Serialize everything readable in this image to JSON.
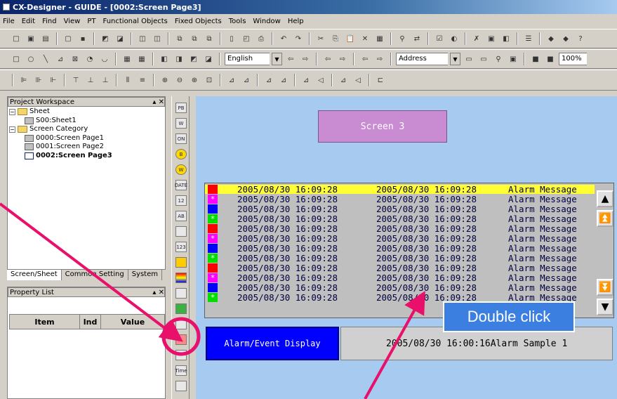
{
  "window": {
    "title": "CX-Designer - GUIDE - [0002:Screen Page3]"
  },
  "menu": [
    "File",
    "Edit",
    "Find",
    "View",
    "PT",
    "Functional Objects",
    "Fixed Objects",
    "Tools",
    "Window",
    "Help"
  ],
  "toolbar2": {
    "language": "English",
    "address": "Address",
    "zoom": "100%"
  },
  "workspace": {
    "title": "Project Workspace",
    "tree": [
      {
        "label": "Sheet",
        "kind": "folder",
        "level": 0
      },
      {
        "label": "S00:Sheet1",
        "kind": "page",
        "level": 1
      },
      {
        "label": "Screen Category",
        "kind": "folder",
        "level": 0
      },
      {
        "label": "0000:Screen Page1",
        "kind": "page",
        "level": 1
      },
      {
        "label": "0001:Screen Page2",
        "kind": "page",
        "level": 1
      },
      {
        "label": "0002:Screen Page3",
        "kind": "page-selected",
        "level": 1
      }
    ],
    "tabs": [
      "Screen/Sheet",
      "Common Setting",
      "System"
    ]
  },
  "property_list": {
    "title": "Property List",
    "columns": [
      "Item",
      "Ind",
      "Value"
    ]
  },
  "objbar": {
    "labels": [
      "PB",
      "W",
      "ON",
      "B",
      "W",
      "DATE",
      "12",
      "AB",
      "",
      "123",
      "",
      "",
      "",
      "",
      "",
      "",
      "",
      "Time",
      ""
    ]
  },
  "canvas": {
    "screen_button": "Screen 3",
    "alarm_rows": [
      {
        "t1": "2005/08/30 16:09:28",
        "t2": "2005/08/30 16:09:28",
        "msg": "Alarm Message",
        "color": "#ff0000",
        "star": false,
        "highlight": true
      },
      {
        "t1": "2005/08/30 16:09:28",
        "t2": "2005/08/30 16:09:28",
        "msg": "Alarm Message",
        "color": "#ff00ff",
        "star": true,
        "highlight": false
      },
      {
        "t1": "2005/08/30 16:09:28",
        "t2": "2005/08/30 16:09:28",
        "msg": "Alarm Message",
        "color": "#0000ff",
        "star": false,
        "highlight": false
      },
      {
        "t1": "2005/08/30 16:09:28",
        "t2": "2005/08/30 16:09:28",
        "msg": "Alarm Message",
        "color": "#00dd00",
        "star": true,
        "highlight": false
      },
      {
        "t1": "2005/08/30 16:09:28",
        "t2": "2005/08/30 16:09:28",
        "msg": "Alarm Message",
        "color": "#ff0000",
        "star": false,
        "highlight": false
      },
      {
        "t1": "2005/08/30 16:09:28",
        "t2": "2005/08/30 16:09:28",
        "msg": "Alarm Message",
        "color": "#ff00ff",
        "star": true,
        "highlight": false
      },
      {
        "t1": "2005/08/30 16:09:28",
        "t2": "2005/08/30 16:09:28",
        "msg": "Alarm Message",
        "color": "#0000ff",
        "star": false,
        "highlight": false
      },
      {
        "t1": "2005/08/30 16:09:28",
        "t2": "2005/08/30 16:09:28",
        "msg": "Alarm Message",
        "color": "#00dd00",
        "star": true,
        "highlight": false
      },
      {
        "t1": "2005/08/30 16:09:28",
        "t2": "2005/08/30 16:09:28",
        "msg": "Alarm Message",
        "color": "#ff0000",
        "star": false,
        "highlight": false
      },
      {
        "t1": "2005/08/30 16:09:28",
        "t2": "2005/08/30 16:09:28",
        "msg": "Alarm Message",
        "color": "#ff00ff",
        "star": true,
        "highlight": false
      },
      {
        "t1": "2005/08/30 16:09:28",
        "t2": "2005/08/30 16:09:28",
        "msg": "Alarm Message",
        "color": "#0000ff",
        "star": false,
        "highlight": false
      },
      {
        "t1": "2005/08/30 16:09:28",
        "t2": "2005/08/30 16:09:28",
        "msg": "Alarm Message",
        "color": "#00dd00",
        "star": true,
        "highlight": false
      }
    ],
    "ae_button": "Alarm/Event Display",
    "ae_status": "2005/08/30 16:00:16Alarm Sample 1"
  },
  "annotation": {
    "callout": "Double click",
    "accent": "#e8106a"
  }
}
